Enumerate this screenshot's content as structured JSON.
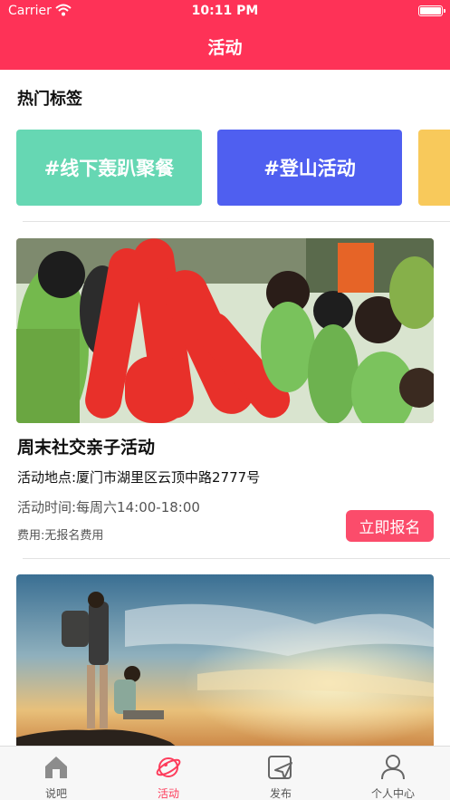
{
  "status_bar": {
    "carrier": "Carrier",
    "time": "10:11 PM"
  },
  "nav": {
    "title": "活动"
  },
  "hot_tags": {
    "title": "热门标签",
    "tags": [
      {
        "label": "#线下轰趴聚餐",
        "color": "#66d7b3"
      },
      {
        "label": "#登山活动",
        "color": "#4f5ff0"
      },
      {
        "label": "",
        "color": "#f8c95b"
      }
    ]
  },
  "activities": [
    {
      "title": "周末社交亲子活动",
      "address": "活动地点:厦门市湖里区云顶中路2777号",
      "time": "活动时间:每周六14:00-18:00",
      "fee": "费用:无报名费用",
      "button": "立即报名",
      "image_icon": "group-event-photo"
    },
    {
      "image_icon": "hikers-sunset-photo"
    }
  ],
  "tabbar": {
    "items": [
      {
        "label": "说吧",
        "icon": "home-icon",
        "active": false
      },
      {
        "label": "活动",
        "icon": "planet-icon",
        "active": true
      },
      {
        "label": "发布",
        "icon": "send-icon",
        "active": false
      },
      {
        "label": "个人中心",
        "icon": "person-icon",
        "active": false
      }
    ]
  },
  "colors": {
    "accent": "#fe3257",
    "tab_active": "#fd3d5c",
    "button": "#fb4c6b"
  }
}
